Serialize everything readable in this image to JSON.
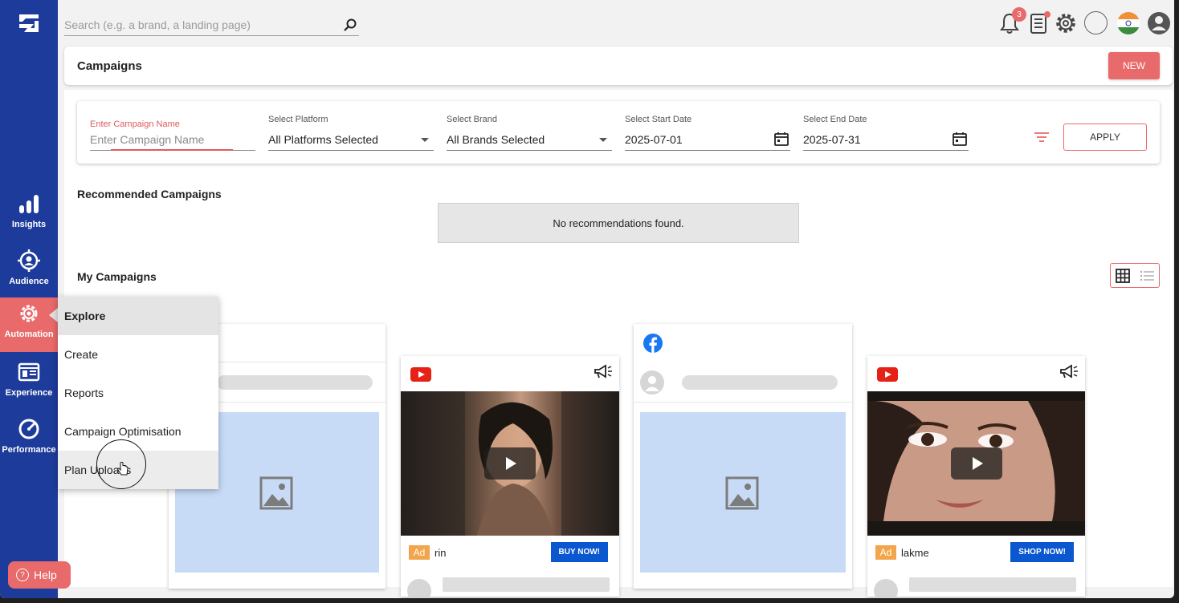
{
  "sidebar": {
    "items": [
      {
        "label": "Insights",
        "icon": "bar-chart-icon"
      },
      {
        "label": "Audience",
        "icon": "target-icon"
      },
      {
        "label": "Automation",
        "icon": "gear-icon",
        "active": true
      },
      {
        "label": "Experience",
        "icon": "layout-icon"
      },
      {
        "label": "Performance",
        "icon": "gauge-icon"
      }
    ],
    "help_label": "Help",
    "accent": "#e86a6a",
    "bg": "#1d3b9a"
  },
  "topbar": {
    "search_placeholder": "Search (e.g. a brand, a landing page)",
    "notification_count": "3"
  },
  "header": {
    "title": "Campaigns",
    "new_label": "NEW"
  },
  "filters": {
    "campaign_name_label": "Enter Campaign Name",
    "campaign_name_placeholder": "Enter Campaign Name",
    "platform_label": "Select Platform",
    "platform_value": "All Platforms Selected",
    "brand_label": "Select Brand",
    "brand_value": "All Brands Selected",
    "start_label": "Select Start Date",
    "start_value": "2025-07-01",
    "end_label": "Select End Date",
    "end_value": "2025-07-31",
    "apply_label": "APPLY"
  },
  "recommended": {
    "title": "Recommended Campaigns",
    "empty_text": "No recommendations found."
  },
  "my_campaigns": {
    "title": "My Campaigns",
    "cards": [
      {
        "platform": "unknown"
      },
      {
        "platform": "youtube",
        "ad_tag": "Ad",
        "brand": "rin",
        "cta": "BUY NOW!"
      },
      {
        "platform": "facebook"
      },
      {
        "platform": "youtube",
        "ad_tag": "Ad",
        "brand": "lakme",
        "cta": "SHOP NOW!"
      }
    ]
  },
  "automation_menu": {
    "items": [
      "Explore",
      "Create",
      "Reports",
      "Campaign Optimisation",
      "Plan Uploads"
    ]
  }
}
